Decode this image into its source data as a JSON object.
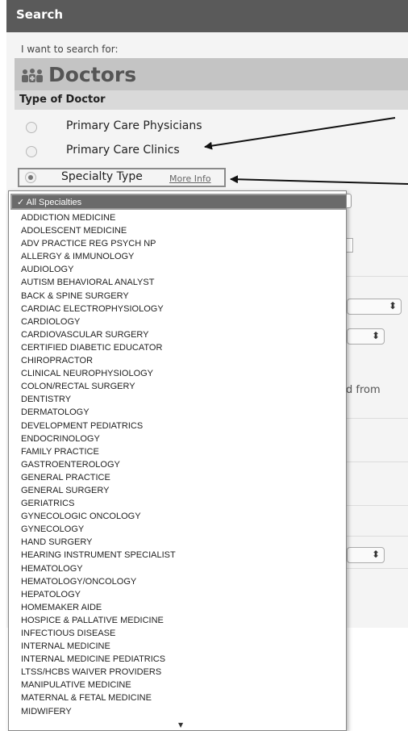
{
  "header": {
    "title": "Search"
  },
  "search": {
    "intro": "I want to search for:",
    "category": "Doctors",
    "category_icon": "doctors-icon",
    "type_heading": "Type of Doctor",
    "options": [
      {
        "label": "Primary Care Physicians",
        "selected": false
      },
      {
        "label": "Primary Care Clinics",
        "selected": false
      },
      {
        "label": "Specialty Type",
        "selected": true
      }
    ],
    "more_info": "More Info"
  },
  "background": {
    "partial_text": "d from",
    "select_arrows": "⬍",
    "colors": {
      "panel": "#f4f4f4",
      "bar": "#c4c4c4",
      "header": "#5a5a5a"
    }
  },
  "specialty_dropdown": {
    "selected": "✓ All Specialties",
    "items": [
      "ADDICTION MEDICINE",
      "ADOLESCENT MEDICINE",
      "ADV PRACTICE REG PSYCH NP",
      "ALLERGY & IMMUNOLOGY",
      "AUDIOLOGY",
      "AUTISM BEHAVIORAL ANALYST",
      "BACK & SPINE SURGERY",
      "CARDIAC ELECTROPHYSIOLOGY",
      "CARDIOLOGY",
      "CARDIOVASCULAR SURGERY",
      "CERTIFIED DIABETIC EDUCATOR",
      "CHIROPRACTOR",
      "CLINICAL NEUROPHYSIOLOGY",
      "COLON/RECTAL SURGERY",
      "DENTISTRY",
      "DERMATOLOGY",
      "DEVELOPMENT PEDIATRICS",
      "ENDOCRINOLOGY",
      "FAMILY PRACTICE",
      "GASTROENTEROLOGY",
      "GENERAL PRACTICE",
      "GENERAL SURGERY",
      "GERIATRICS",
      "GYNECOLOGIC ONCOLOGY",
      "GYNECOLOGY",
      "HAND SURGERY",
      "HEARING INSTRUMENT SPECIALIST",
      "HEMATOLOGY",
      "HEMATOLOGY/ONCOLOGY",
      "HEPATOLOGY",
      "HOMEMAKER AIDE",
      "HOSPICE & PALLATIVE MEDICINE",
      "INFECTIOUS DISEASE",
      "INTERNAL MEDICINE",
      "INTERNAL MEDICINE PEDIATRICS",
      "LTSS/HCBS WAIVER PROVIDERS",
      "MANIPULATIVE MEDICINE",
      "MATERNAL & FETAL MEDICINE",
      "MIDWIFERY"
    ],
    "scroll_indicator": "▼"
  }
}
